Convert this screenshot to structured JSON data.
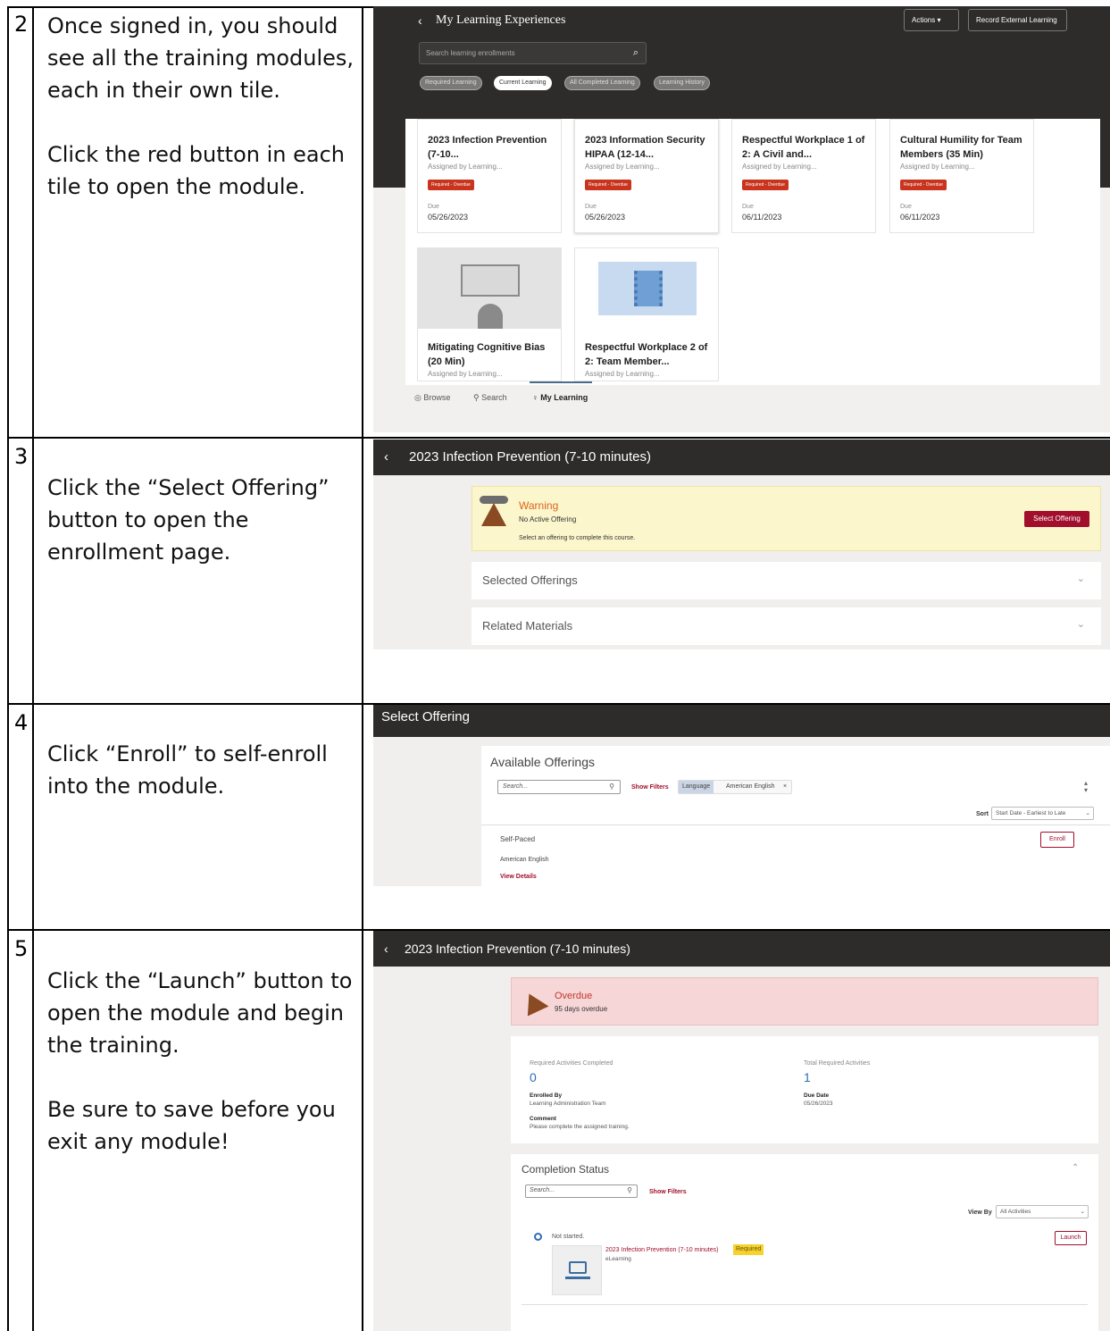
{
  "steps": [
    {
      "number": "2",
      "instructions": [
        "Once signed in, you should see all the training modules, each in their own tile.",
        "Click the red button in each tile to open the module."
      ]
    },
    {
      "number": "3",
      "instructions": [
        "Click the “Select Offering” button to open the enrollment page."
      ]
    },
    {
      "number": "4",
      "instructions": [
        "Click “Enroll” to self-enroll into the module."
      ]
    },
    {
      "number": "5",
      "instructions": [
        "Click the “Launch” button to open the module and begin the training.",
        "Be sure to save before you exit any module!"
      ]
    }
  ],
  "my_learning": {
    "back_icon": "chevron-left-icon",
    "title": "My Learning Experiences",
    "actions_label": "Actions ▾",
    "record_label": "Record External Learning",
    "search_placeholder": "Search learning enrollments",
    "filter_chips": [
      "Required Learning",
      "Current Learning",
      "All Completed Learning",
      "Learning History"
    ],
    "active_chip": "Current Learning",
    "tiles": [
      {
        "title": "2023 Infection Prevention (7-10...",
        "assigned": "Assigned by Learning...",
        "badge": "Required - Overdue",
        "due_label": "Due",
        "due": "05/26/2023"
      },
      {
        "title": "2023 Information Security HIPAA (12-14...",
        "assigned": "Assigned by Learning...",
        "badge": "Required - Overdue",
        "due_label": "Due",
        "due": "05/26/2023"
      },
      {
        "title": "Respectful Workplace 1 of 2: A Civil and...",
        "assigned": "Assigned by Learning...",
        "badge": "Required - Overdue",
        "due_label": "Due",
        "due": "06/11/2023"
      },
      {
        "title": "Cultural Humility for Team Members (35 Min)",
        "assigned": "Assigned by Learning...",
        "badge": "Required - Overdue",
        "due_label": "Due",
        "due": "06/11/2023"
      },
      {
        "title": "Mitigating Cognitive Bias (20 Min)",
        "assigned": "Assigned by Learning..."
      },
      {
        "title": "Respectful Workplace 2 of 2: Team Member...",
        "assigned": "Assigned by Learning..."
      }
    ],
    "nav": [
      "Browse",
      "Search",
      "My Learning"
    ],
    "nav_icons": [
      "eye-icon",
      "search-icon",
      "lightbulb-icon"
    ],
    "colors": {
      "dark": "#2d2c2a",
      "badge": "#c8341d"
    }
  },
  "course_page": {
    "title": "2023 Infection Prevention (7-10 minutes)",
    "warning_title": "Warning",
    "warning_sub": "No Active Offering",
    "warning_text": "Select an offering to complete this course.",
    "select_offering_label": "Select Offering",
    "accordions": [
      "Selected Offerings",
      "Related Materials"
    ]
  },
  "select_offering": {
    "title": "Select Offering",
    "available_title": "Available Offerings",
    "search_placeholder": "Search...",
    "show_filters": "Show Filters",
    "filter_key": "Language",
    "filter_value": "American English",
    "sort_label": "Sort",
    "sort_value": "Start Date - Earliest to Late",
    "offering_type": "Self-Paced",
    "offering_language": "American English",
    "view_details": "View Details",
    "enroll_label": "Enroll"
  },
  "launch_page": {
    "title": "2023 Infection Prevention (7-10 minutes)",
    "overdue_title": "Overdue",
    "overdue_text": "95 days overdue",
    "req_completed_label": "Required Activities Completed",
    "req_completed_value": "0",
    "total_required_label": "Total Required Activities",
    "total_required_value": "1",
    "enrolled_by_label": "Enrolled By",
    "enrolled_by_value": "Learning Administration Team",
    "due_date_label": "Due Date",
    "due_date_value": "05/26/2023",
    "comment_label": "Comment",
    "comment_value": "Please complete the assigned training.",
    "completion_title": "Completion Status",
    "search_placeholder": "Search...",
    "show_filters": "Show Filters",
    "view_by_label": "View By",
    "view_by_value": "All Activities",
    "status": "Not started.",
    "activity_title": "2023 Infection Prevention (7-10 minutes)",
    "required_badge": "Required",
    "activity_type": "eLearning",
    "launch_label": "Launch"
  }
}
